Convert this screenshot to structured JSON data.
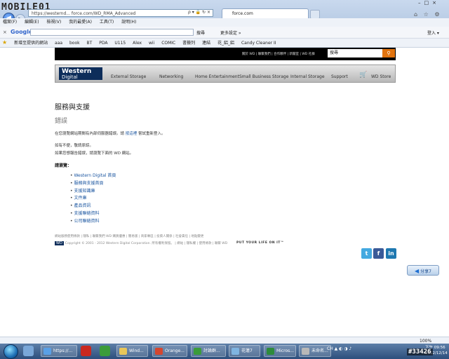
{
  "window": {
    "watermark": "MOBILE01",
    "address": "https://westernd... force.com/WD_RMA_Advanced",
    "address_icons": "ρ ▾ 🔒 ↻ ×",
    "active_tab": "force.com",
    "top_right_icons": "⌂ ☆ ⚙"
  },
  "menu": [
    "檔案(F)",
    "編輯(E)",
    "檢視(V)",
    "我的最愛(A)",
    "工具(T)",
    "說明(H)"
  ],
  "google_toolbar": {
    "close": "×",
    "logo": "Google",
    "search_button": "搜尋",
    "more": "更多設定 »",
    "signin": "登入 ▾"
  },
  "favorites": [
    "新增至提供的網站",
    "aaa",
    "book",
    "BT",
    "PDA",
    "U115",
    "Alex",
    "wii",
    "COMIC",
    "書籤列",
    "連結",
    "花_絽_絽",
    "Candy Cleaner II"
  ],
  "wd": {
    "top_links": "關於 WD | 聯繫我們 | 合作夥伴 | 新聞室 | WD 社群",
    "search_value": "搜尋",
    "logo_line1": "Western",
    "logo_line2": "Digital",
    "nav": [
      "External Storage",
      "Networking",
      "Home Entertainment",
      "Small Business Storage",
      "Internal Storage",
      "Support",
      "WD Store"
    ]
  },
  "content": {
    "page_title": "服務與支援",
    "error_title": "錯誤",
    "line1_before": "在您瀏覽網站期間有內部伺服器錯誤。請",
    "line1_link": "按這裡",
    "line1_after": "嘗試重新登入。",
    "line2": "如有不便，敬請原諒。",
    "line3": "如果您想報告錯誤，請瀏覽下面的 WD 網站。",
    "browse_label": "請瀏覽：",
    "links": [
      "Western Digital 首頁",
      "服務與支援首頁",
      "支援知識庫",
      "文件庫",
      "產品資訊",
      "支援聯絡資料",
      "公司聯絡資料"
    ]
  },
  "footer": {
    "links": "網站服務使用條款 | 隱私 | 聯繫我們 WD 購買優惠 | 簡易版 | 商家專區 | 投資人關係 | 社會責任 | 地點變更",
    "copyright": "Copyright © 2001 - 2012 Western Digital Corporation. 所有權利保留。 | 網站 | 隱私權 | 使用條款 | 聯繫 WD",
    "wd_mini": "WD",
    "tagline": "PUT YOUR LIFE ON IT™",
    "twitter": "t",
    "facebook": "f",
    "linkedin": "in",
    "side_button": "分享7"
  },
  "statusbar": {
    "zoom": "100%"
  },
  "taskbar": {
    "items": [
      "https://...",
      "Wind...",
      "Orange...",
      "討論群...",
      "花蓮7",
      "Micros...",
      "未命名..."
    ],
    "tray": "CH ▲ ◐ ◑ ♪",
    "clock_time": "下午 09:56",
    "clock_date": "2012/12/14",
    "post_id": "#33426"
  },
  "colors": {
    "wd_orange": "#e2740f",
    "wd_navy": "#0d2d5a",
    "link_blue": "#1a55a0"
  }
}
